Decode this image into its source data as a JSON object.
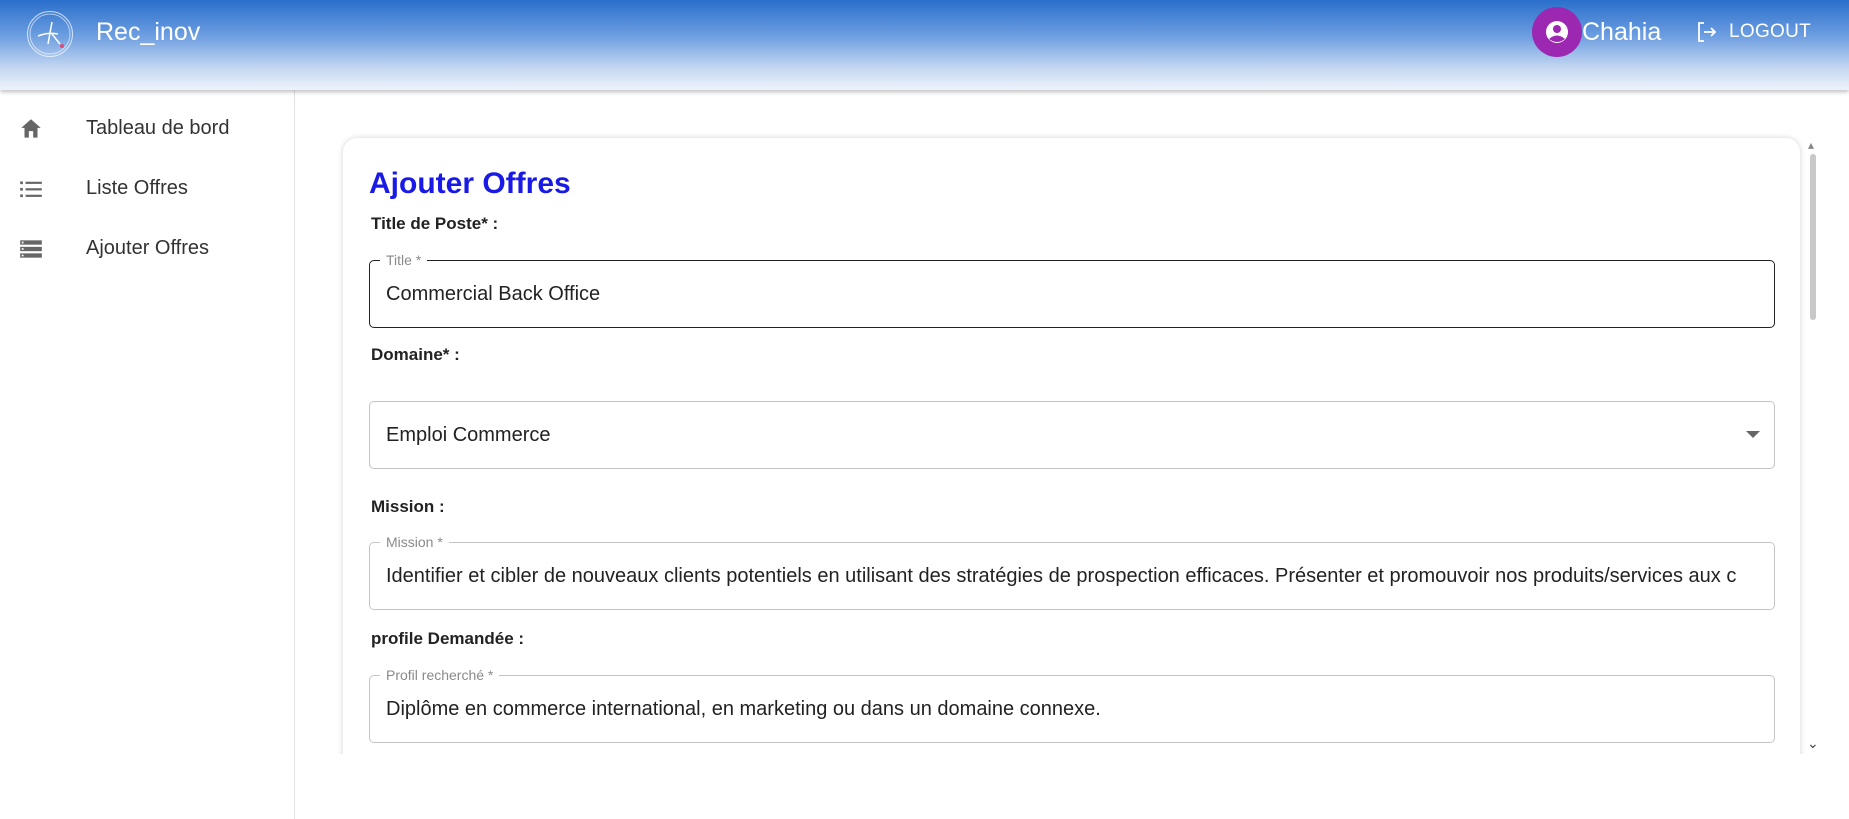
{
  "header": {
    "app_title": "Rec_inov",
    "user_name": "Chahia",
    "logout_label": "LOGOUT",
    "colors": {
      "gradient_top": "#2a6fcc",
      "avatar": "#9c27b0"
    }
  },
  "sidebar": {
    "items": [
      {
        "label": "Tableau de bord",
        "icon": "home-icon"
      },
      {
        "label": "Liste Offres",
        "icon": "list-icon"
      },
      {
        "label": "Ajouter Offres",
        "icon": "storage-icon"
      }
    ]
  },
  "form": {
    "title": "Ajouter Offres",
    "title_color": "#1a1ae6",
    "poste": {
      "section_label": "Title de Poste* :",
      "legend": "Title *",
      "value": "Commercial Back Office"
    },
    "domaine": {
      "section_label": "Domaine* :",
      "value": "Emploi Commerce"
    },
    "mission": {
      "section_label": "Mission :",
      "legend": "Mission *",
      "value": "Identifier et cibler de nouveaux clients potentiels en utilisant des stratégies de prospection efficaces. Présenter et promouvoir nos produits/services aux c"
    },
    "profil": {
      "section_label": "profile Demandée :",
      "legend": "Profil recherché *",
      "value": "Diplôme en commerce international, en marketing ou dans un domaine connexe."
    }
  }
}
